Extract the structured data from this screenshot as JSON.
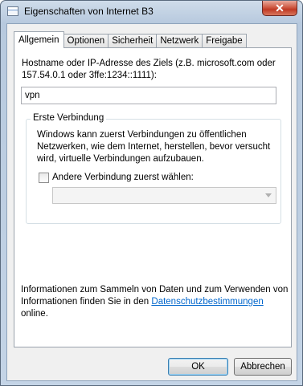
{
  "window": {
    "title": "Eigenschaften von Internet B3",
    "close_glyph": "✕"
  },
  "tabs": [
    {
      "label": "Allgemein",
      "active": true
    },
    {
      "label": "Optionen",
      "active": false
    },
    {
      "label": "Sicherheit",
      "active": false
    },
    {
      "label": "Netzwerk",
      "active": false
    },
    {
      "label": "Freigabe",
      "active": false
    }
  ],
  "general": {
    "host_description": "Hostname oder IP-Adresse des Ziels (z.B. microsoft.com oder 157.54.0.1 oder 3ffe:1234::1111):",
    "host_value": "vpn",
    "first_connection": {
      "legend": "Erste Verbindung",
      "text": "Windows kann zuerst Verbindungen zu öffentlichen Netzwerken, wie dem Internet, herstellen, bevor versucht wird, virtuelle Verbindungen aufzubauen.",
      "checkbox_label": "Andere Verbindung zuerst wählen:",
      "checkbox_checked": false,
      "combo_value": ""
    },
    "info_text_before": "Informationen zum Sammeln von Daten und zum Verwenden von Informationen finden Sie in den ",
    "info_link": "Datenschutzbestimmungen",
    "info_text_after": " online."
  },
  "buttons": {
    "ok": "OK",
    "cancel": "Abbrechen"
  }
}
